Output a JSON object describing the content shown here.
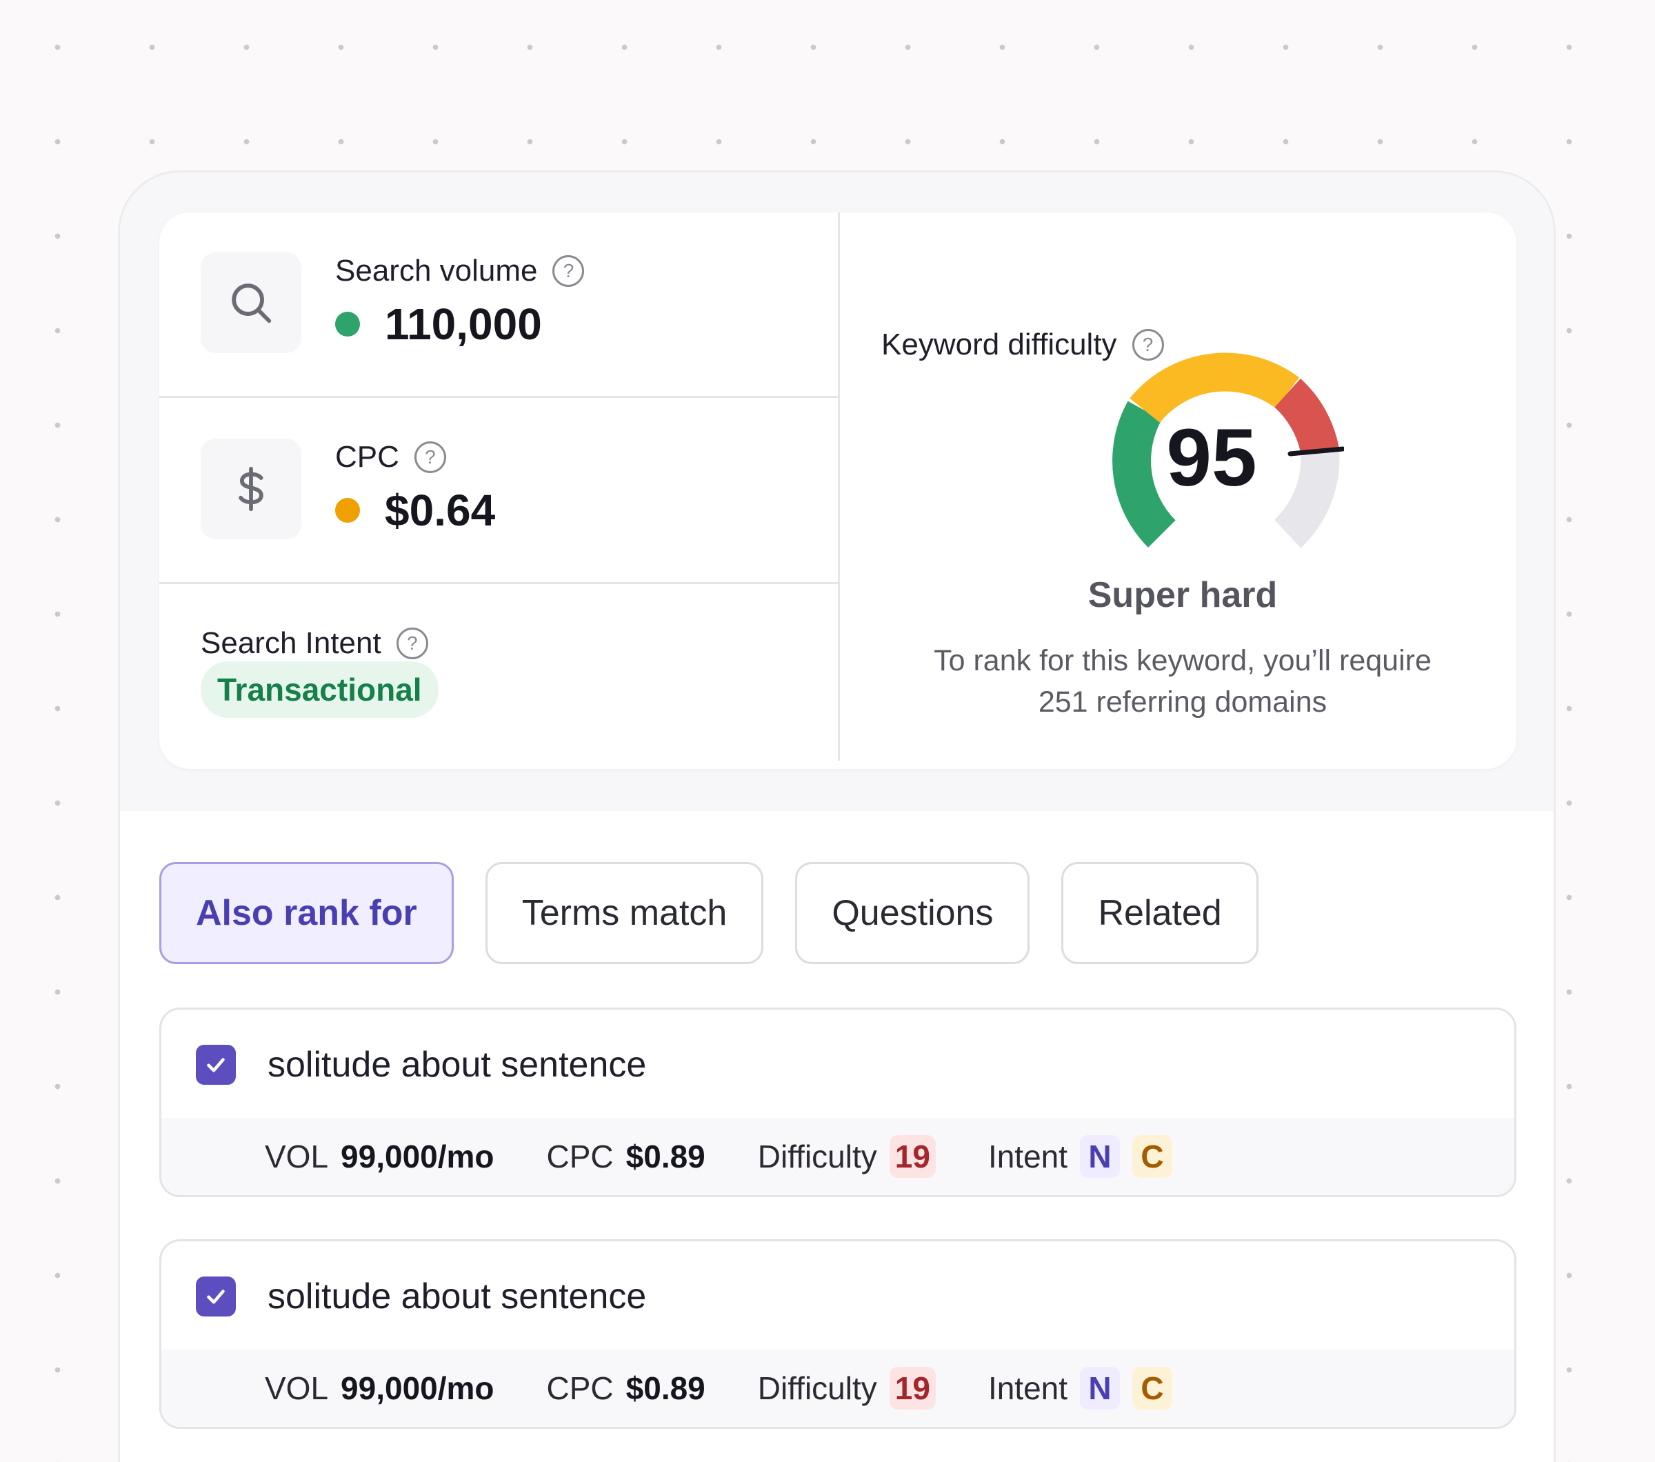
{
  "metrics": {
    "search_volume": {
      "label": "Search volume",
      "value": "110,000",
      "status_color": "#2ea36b",
      "icon": "search-icon"
    },
    "cpc": {
      "label": "CPC",
      "value": "$0.64",
      "status_color": "#f0a000",
      "icon": "dollar-icon"
    },
    "search_intent": {
      "label": "Search Intent",
      "value": "Transactional"
    },
    "help_glyph": "?"
  },
  "keyword_difficulty": {
    "label": "Keyword difficulty",
    "score": "95",
    "level": "Super hard",
    "description_line1": "To rank for this keyword, you’ll require",
    "description_line2": "251 referring domains",
    "gauge_colors": {
      "easy": "#2ea36b",
      "medium": "#fbb922",
      "hard": "#d9534f",
      "track": "#e7e7eb"
    }
  },
  "tabs": [
    {
      "label": "Also rank for",
      "active": true
    },
    {
      "label": "Terms match",
      "active": false
    },
    {
      "label": "Questions",
      "active": false
    },
    {
      "label": "Related",
      "active": false
    }
  ],
  "keywords": [
    {
      "checked": true,
      "title": "solitude about sentence",
      "vol_label": "VOL",
      "vol": "99,000/mo",
      "cpc_label": "CPC",
      "cpc": "$0.89",
      "difficulty_label": "Difficulty",
      "difficulty": "19",
      "intent_label": "Intent",
      "intent_n": "N",
      "intent_c": "C"
    },
    {
      "checked": true,
      "title": "solitude about sentence",
      "vol_label": "VOL",
      "vol": "99,000/mo",
      "cpc_label": "CPC",
      "cpc": "$0.89",
      "difficulty_label": "Difficulty",
      "difficulty": "19",
      "intent_label": "Intent",
      "intent_n": "N",
      "intent_c": "C"
    }
  ],
  "colors": {
    "accent": "#5d4ec0",
    "transactional": "#17804a"
  }
}
